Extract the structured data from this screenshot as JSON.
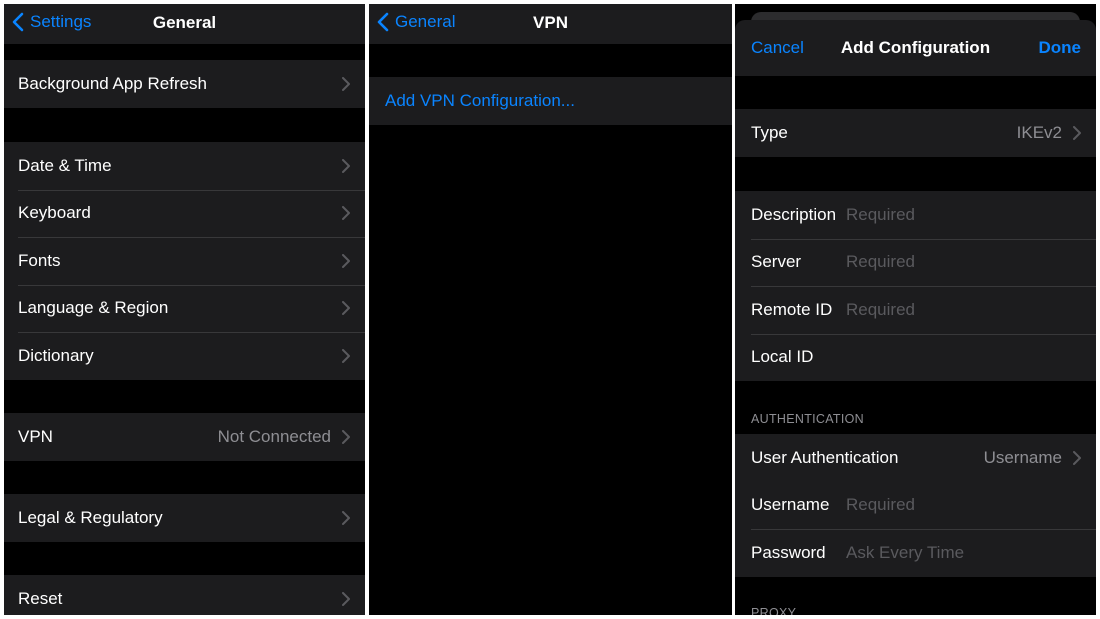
{
  "general": {
    "back_label": "Settings",
    "title": "General",
    "groups": [
      {
        "items": [
          {
            "label": "Background App Refresh"
          }
        ]
      },
      {
        "items": [
          {
            "label": "Date & Time"
          },
          {
            "label": "Keyboard"
          },
          {
            "label": "Fonts"
          },
          {
            "label": "Language & Region"
          },
          {
            "label": "Dictionary"
          }
        ]
      },
      {
        "items": [
          {
            "label": "VPN",
            "value": "Not Connected"
          }
        ]
      },
      {
        "items": [
          {
            "label": "Legal & Regulatory"
          }
        ]
      },
      {
        "items": [
          {
            "label": "Reset"
          }
        ]
      }
    ]
  },
  "vpn": {
    "back_label": "General",
    "title": "VPN",
    "add_label": "Add VPN Configuration..."
  },
  "config": {
    "cancel_label": "Cancel",
    "title": "Add Configuration",
    "done_label": "Done",
    "type": {
      "label": "Type",
      "value": "IKEv2"
    },
    "fields": [
      {
        "label": "Description",
        "placeholder": "Required"
      },
      {
        "label": "Server",
        "placeholder": "Required"
      },
      {
        "label": "Remote ID",
        "placeholder": "Required"
      },
      {
        "label": "Local ID",
        "placeholder": ""
      }
    ],
    "auth_header": "AUTHENTICATION",
    "user_auth": {
      "label": "User Authentication",
      "value": "Username"
    },
    "auth_fields": [
      {
        "label": "Username",
        "placeholder": "Required"
      },
      {
        "label": "Password",
        "placeholder": "Ask Every Time"
      }
    ],
    "proxy_header": "PROXY"
  },
  "colors": {
    "accent": "#0a84ff",
    "cell_background": "#1c1c1e",
    "background": "#000000",
    "secondary_text": "#8e8e93"
  }
}
